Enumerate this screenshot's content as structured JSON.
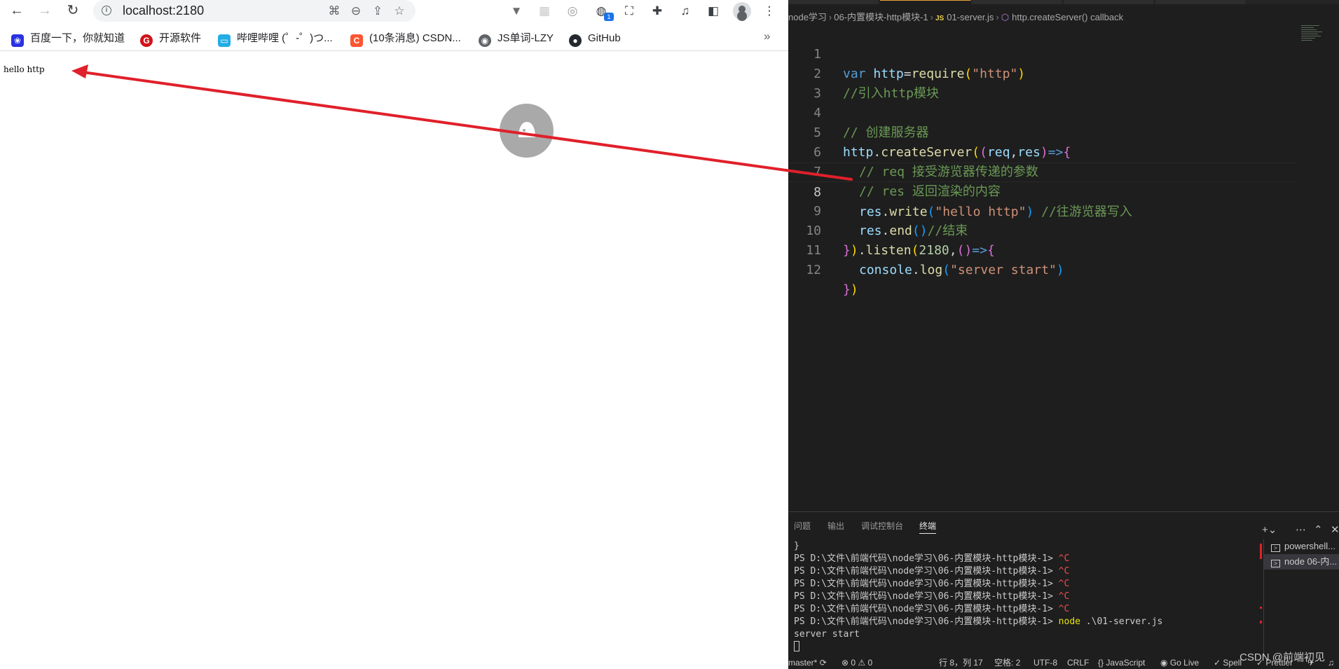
{
  "browser": {
    "url": "localhost:2180",
    "bookmarks": [
      {
        "label": "百度一下，你就知道",
        "icon": "baidu-icon",
        "color": "#2932e1"
      },
      {
        "label": "开源软件",
        "icon": "oschina-icon",
        "color": "#d1131a"
      },
      {
        "label": "哔哩哔哩 (゜-゜)つ...",
        "icon": "bilibili-icon",
        "color": "#23ade5"
      },
      {
        "label": "(10条消息) CSDN...",
        "icon": "csdn-icon",
        "color": "#fc5531"
      },
      {
        "label": "JS单词-LZY",
        "icon": "globe-icon",
        "color": "#5f6368"
      },
      {
        "label": "GitHub",
        "icon": "github-icon",
        "color": "#24292f"
      }
    ],
    "more_bookmarks": "»",
    "extension_badge": "1",
    "page_text": "hello http"
  },
  "vscode": {
    "breadcrumb": {
      "folder1": "node学习",
      "folder2": "06-内置模块-http模块-1",
      "js_badge": "JS",
      "file": "01-server.js",
      "symbol": "http.createServer() callback"
    },
    "code_lines": [
      {
        "n": "1"
      },
      {
        "n": "2"
      },
      {
        "n": "3"
      },
      {
        "n": "4"
      },
      {
        "n": "5"
      },
      {
        "n": "6"
      },
      {
        "n": "7"
      },
      {
        "n": "8"
      },
      {
        "n": "9"
      },
      {
        "n": "10"
      },
      {
        "n": "11"
      },
      {
        "n": "12"
      }
    ],
    "code_text": {
      "l1_kw": "var",
      "l1_var": "http",
      "l1_eq": "=",
      "l1_fn": "require",
      "l1_str": "\"http\"",
      "l2": "//引入http模块",
      "l4": "// 创建服务器",
      "l5_obj": "http",
      "l5_fn": "createServer",
      "l5_params": "req",
      "l5_params2": "res",
      "l5_arrow": "=>",
      "l6": "// req 接受游览器传递的参数",
      "l7": "// res 返回渲染的内容",
      "l8_obj": "res",
      "l8_fn": "write",
      "l8_str": "\"hello http\"",
      "l8_com": "//往游览器写入",
      "l9_obj": "res",
      "l9_fn": "end",
      "l9_com": "//结束",
      "l10_fn": "listen",
      "l10_num": "2180",
      "l10_arrow": "=>",
      "l11_obj": "console",
      "l11_fn": "log",
      "l11_str": "\"server start\""
    },
    "panel": {
      "tabs": [
        "问题",
        "输出",
        "调试控制台",
        "终端"
      ],
      "active_tab": "终端",
      "terminal_lines": [
        {
          "prompt": "}",
          "cmd": "",
          "arg": ""
        },
        {
          "prompt": "PS D:\\文件\\前端代码\\node学习\\06-内置模块-http模块-1> ",
          "cmd": "^C",
          "arg": ""
        },
        {
          "prompt": "PS D:\\文件\\前端代码\\node学习\\06-内置模块-http模块-1> ",
          "cmd": "^C",
          "arg": ""
        },
        {
          "prompt": "PS D:\\文件\\前端代码\\node学习\\06-内置模块-http模块-1> ",
          "cmd": "^C",
          "arg": ""
        },
        {
          "prompt": "PS D:\\文件\\前端代码\\node学习\\06-内置模块-http模块-1> ",
          "cmd": "^C",
          "arg": ""
        },
        {
          "prompt": "PS D:\\文件\\前端代码\\node学习\\06-内置模块-http模块-1> ",
          "cmd": "^C",
          "arg": ""
        },
        {
          "prompt": "PS D:\\文件\\前端代码\\node学习\\06-内置模块-http模块-1> ",
          "cmd": "node",
          "arg": " .\\01-server.js"
        },
        {
          "prompt": "server start",
          "cmd": "",
          "arg": ""
        }
      ],
      "terminals": [
        "powershell...",
        "node 06-内..."
      ]
    },
    "status_bar": {
      "branch": "master*",
      "problems": "⊗ 0 ⚠ 0",
      "position": "行 8，列 17",
      "spaces": "空格: 2",
      "encoding": "UTF-8",
      "eol": "CRLF",
      "language": "{} JavaScript",
      "golive": "Go Live",
      "spell": "✓ Spell",
      "prettier": "✓ Prettier"
    },
    "watermark": "CSDN @前端初见"
  },
  "annotation_color": "#e0202a"
}
